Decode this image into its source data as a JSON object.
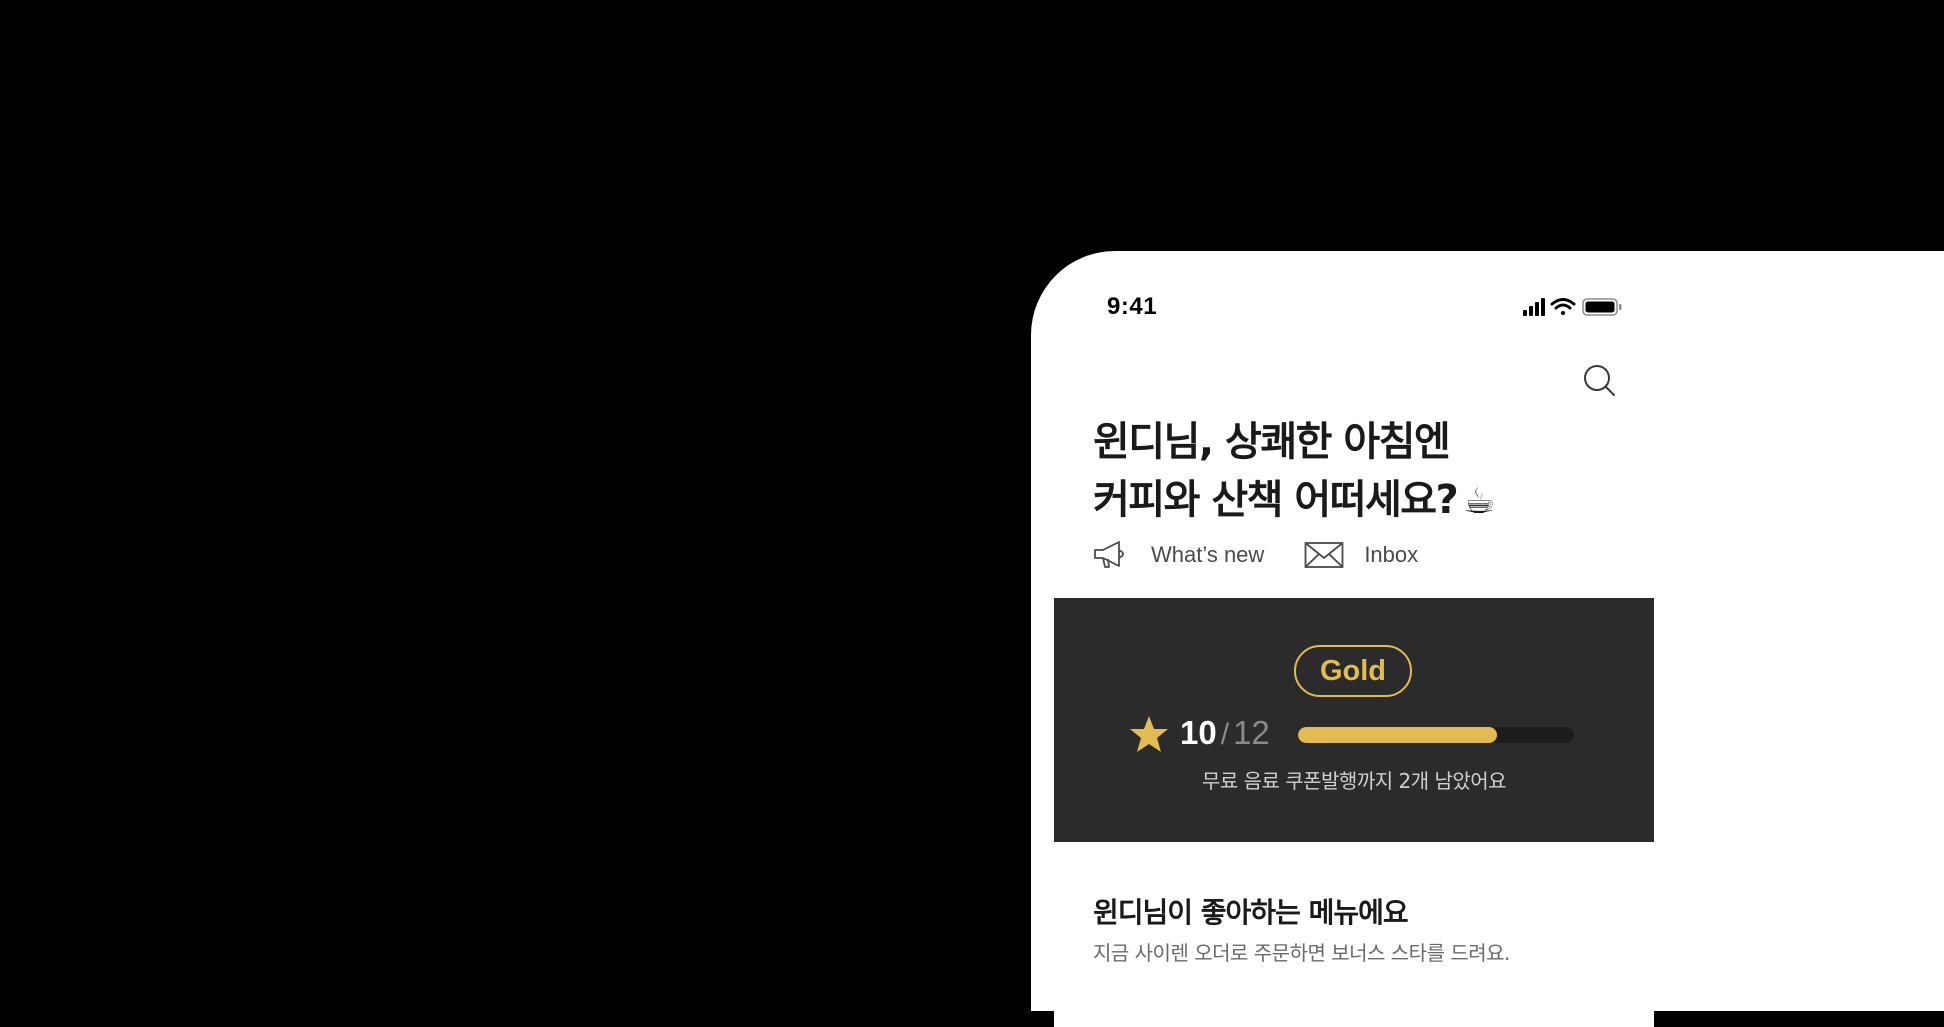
{
  "status_bar": {
    "time": "9:41",
    "icons": [
      "cellular-signal-icon",
      "wifi-icon",
      "battery-icon"
    ]
  },
  "header": {
    "search_icon": "search-icon",
    "greeting_line1": "윈디님, 상쾌한 아침엔",
    "greeting_line2": "커피와 산책 어떠세요?",
    "greeting_emoji": "☕"
  },
  "quick_links": [
    {
      "label": "What’s new",
      "icon": "megaphone-icon"
    },
    {
      "label": "Inbox",
      "icon": "mail-icon"
    }
  ],
  "rewards": {
    "tier": "Gold",
    "stars_current": "10",
    "stars_separator": "/",
    "stars_total": "12",
    "progress": 0.72,
    "note": "무료 음료 쿠폰발행까지 2개 남았어요",
    "colors": {
      "accent": "#e2bc50",
      "panel": "#2b2b2b"
    }
  },
  "favorites": {
    "title": "윈디님이 좋아하는 메뉴에요",
    "subtitle": "지금 사이렌 오더로 주문하면 보너스 스타를 드려요."
  }
}
